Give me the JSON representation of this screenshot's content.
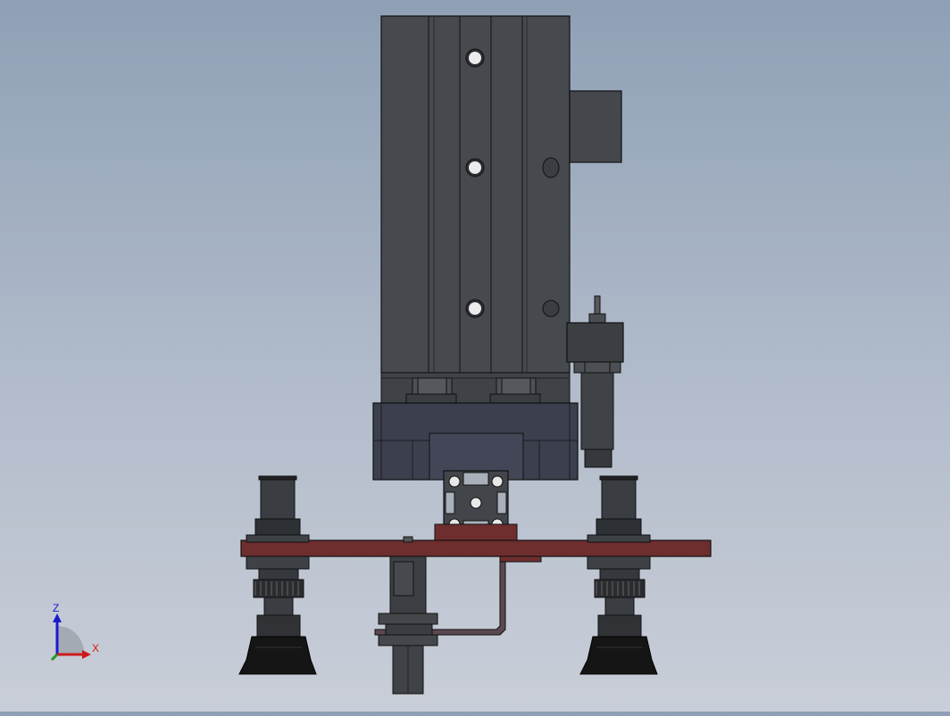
{
  "viewport": {
    "background_top": "#8fa0b6",
    "background_bottom": "#c9ced8"
  },
  "triad": {
    "z_label": "Z",
    "x_label": "X",
    "z_color": "#1a1acc",
    "x_color": "#cc1a1a",
    "y_color": "#1a9a1a"
  },
  "colors": {
    "metal_dark": "#3e4146",
    "metal_mid": "#4a4d52",
    "mount_plate": "#6e2e2e",
    "suction_cup": "#151515",
    "block_blue": "#3c3f4e"
  }
}
